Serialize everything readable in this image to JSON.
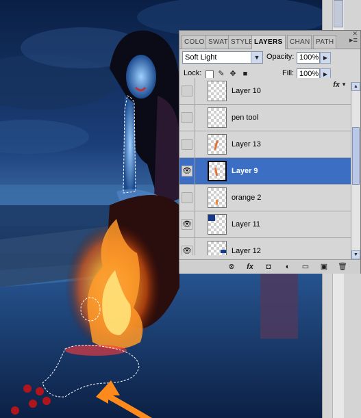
{
  "panel": {
    "tabs": [
      {
        "label": "COLO",
        "active": false
      },
      {
        "label": "SWAT",
        "active": false
      },
      {
        "label": "STYLE",
        "active": false
      },
      {
        "label": "LAYERS",
        "active": true
      },
      {
        "label": "CHAN",
        "active": false
      },
      {
        "label": "PATH",
        "active": false
      }
    ],
    "close_glyph": "✕",
    "menu_glyph": "▸≡",
    "blend_mode": "Soft Light",
    "opacity_label": "Opacity:",
    "opacity_value": "100%",
    "lock_label": "Lock:",
    "fill_label": "Fill:",
    "fill_value": "100%",
    "layers": [
      {
        "name": "Layer 10",
        "visible": false,
        "selected": false,
        "fx": true,
        "thumb": "blank"
      },
      {
        "name": "pen tool",
        "visible": false,
        "selected": false,
        "fx": false,
        "thumb": "blank"
      },
      {
        "name": "Layer 13",
        "visible": false,
        "selected": false,
        "fx": false,
        "thumb": "orange-stroke"
      },
      {
        "name": "Layer 9",
        "visible": true,
        "selected": true,
        "fx": false,
        "thumb": "orange-stroke"
      },
      {
        "name": "orange 2",
        "visible": false,
        "selected": false,
        "fx": false,
        "thumb": "orange-dot"
      },
      {
        "name": "Layer 11",
        "visible": true,
        "selected": false,
        "fx": false,
        "thumb": "blue-corner"
      },
      {
        "name": "Layer 12",
        "visible": true,
        "selected": false,
        "fx": false,
        "thumb": "blue-right"
      }
    ],
    "fx_label": "fx",
    "eye_glyph": "👁",
    "bottom_icons": [
      {
        "name": "link-layers-icon",
        "glyph": "⊗"
      },
      {
        "name": "layer-style-icon",
        "glyph": "fx"
      },
      {
        "name": "add-mask-icon",
        "glyph": "◘"
      },
      {
        "name": "adjustment-layer-icon",
        "glyph": "◐"
      },
      {
        "name": "new-group-icon",
        "glyph": "▭"
      },
      {
        "name": "new-layer-icon",
        "glyph": "▣"
      },
      {
        "name": "delete-layer-icon",
        "glyph": "🗑"
      }
    ]
  },
  "colors": {
    "selection": "#3c6fc4",
    "panel_bg": "#d6d6d6",
    "fire": "#ff8a1c"
  }
}
